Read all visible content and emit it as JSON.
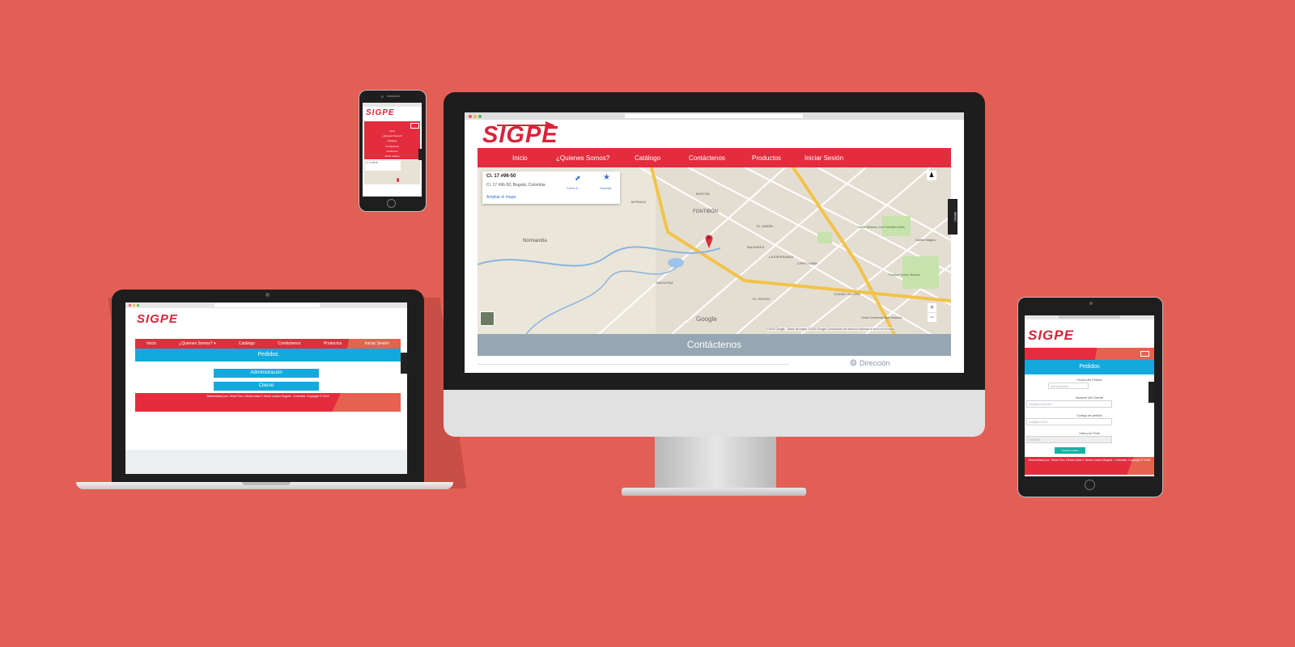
{
  "colors": {
    "background": "#e25f55",
    "brand_red": "#e32c3e",
    "accent_blue": "#13a9dc",
    "contact_band": "#96a6b2"
  },
  "brand": {
    "logo_text": "SIGPE"
  },
  "desktop": {
    "nav": [
      "Inicio",
      "¿Quienes Somos?",
      "Catálogo",
      "Contáctenos",
      "Productos",
      "Iniciar Sesión"
    ],
    "map_card": {
      "title": "Cl. 17 #96-50",
      "address": "Cl. 17 #96-50, Bogotá, Colombia",
      "link": "Ampliar el mapa",
      "directions": "Cómo ll...",
      "save": "Guardar"
    },
    "map_labels": [
      "FONTIBÓN",
      "Normandía",
      "MORAVIA",
      "BOSTON",
      "SANTA PAZ",
      "BALEARES",
      "EL JARDÍN",
      "CAPELLANÍA",
      "LA ESPERANZA",
      "Parque Simón Bolívar",
      "Jardín Botánico José Celestino Mutis",
      "CIUDAD SALITRE",
      "Centro Comercial Gran Estación",
      "EL VERGEL",
      "Salitre Mágico"
    ],
    "map_attrib": "©2015 Google - Datos del mapa ©2015 Google   Condiciones del servicio   Informar un error en el mapa",
    "google_label": "Google",
    "side_tab": "MENÚ",
    "contact_title": "Contáctenos",
    "direccion_label": "Dirección"
  },
  "laptop": {
    "nav": [
      "Inicio",
      "¿Quienes Somos? ▾",
      "Catálogo",
      "Contáctenos",
      "Productos",
      "Iniciar Sesión"
    ],
    "header": "Pedidos",
    "buttons": [
      "Administración",
      "Cliente"
    ],
    "footer": "Desarrollado por: Yeinel Toro, Héctor Arias Y Jimmi Lozano Bogotá - Colombia. Copyright © 2015"
  },
  "tablet": {
    "header": "Pedidos",
    "fields": [
      {
        "label": "Fecha del Pedido",
        "placeholder": "dd/mm/aaaa"
      },
      {
        "label": "Nombre del Cliente",
        "placeholder": "Sangita Nouvee"
      },
      {
        "label": "Codigo de pedido",
        "placeholder": "Sangita #010"
      },
      {
        "label": "Valor por Total",
        "placeholder": "000000"
      }
    ],
    "submit": "Guardar pedido",
    "footer": "Desarrollado por: Yeinel Toro, Héctor Arias Y Jimmi Lozano Bogotá - Colombia. Copyright © 2015"
  },
  "phone": {
    "menu": [
      "Inicio",
      "¿Quienes Somos?",
      "Catálogo",
      "Contáctenos",
      "Productos",
      "Iniciar Sesión"
    ],
    "card_title": "Cl. 17 #96-50"
  }
}
